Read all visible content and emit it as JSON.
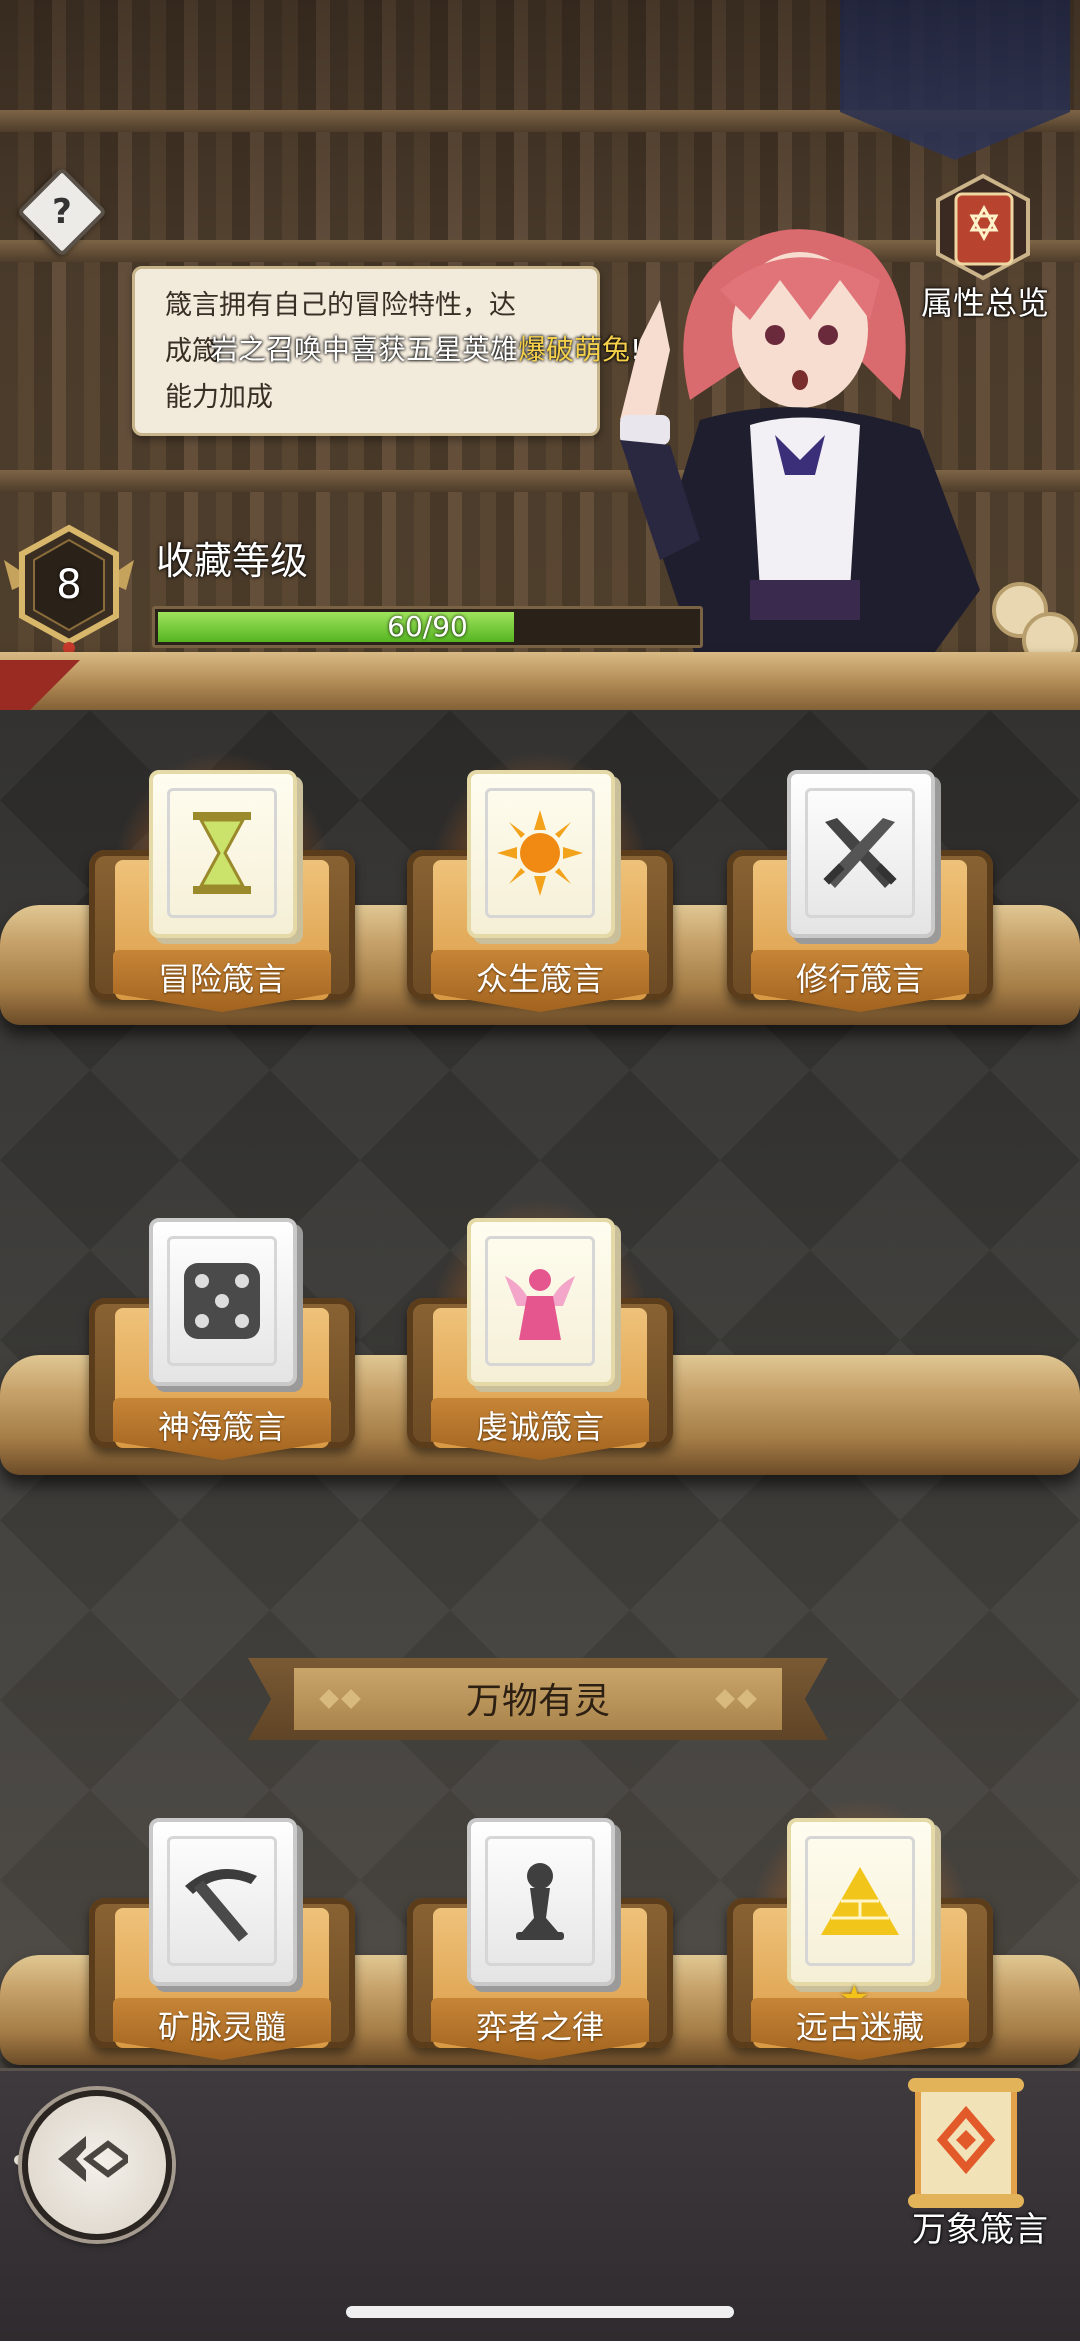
{
  "header": {
    "help_symbol": "?",
    "attributes_label": "属性总览"
  },
  "tooltip": {
    "text": "箴言拥有自己的冒险特性，达成箴言之收集可获得能力加成",
    "line1": "箴言拥有自己的冒险特性，达",
    "line2": "成箴",
    "line3": "能力加成"
  },
  "marquee": {
    "prefix": "岩之召唤中喜获五星英雄",
    "highlight": "爆破萌兔",
    "suffix": "!"
  },
  "collection": {
    "level": "8",
    "label": "收藏等级",
    "progress_text": "60/90",
    "progress_fraction": 0.6667
  },
  "shelf_row1": [
    {
      "label": "冒险箴言",
      "icon": "hourglass-icon",
      "state": "glowing"
    },
    {
      "label": "众生箴言",
      "icon": "sun-icon",
      "state": "glowing"
    },
    {
      "label": "修行箴言",
      "icon": "crossed-swords-icon",
      "state": "grey"
    }
  ],
  "shelf_row2": [
    {
      "label": "神海箴言",
      "icon": "dice-icon",
      "state": "grey"
    },
    {
      "label": "虔诚箴言",
      "icon": "angel-icon",
      "state": "glowing"
    }
  ],
  "section": {
    "title": "万物有灵"
  },
  "shelf_row3": [
    {
      "label": "矿脉灵髓",
      "icon": "pickaxe-icon",
      "state": "grey"
    },
    {
      "label": "弈者之律",
      "icon": "chess-pawn-icon",
      "state": "grey"
    },
    {
      "label": "远古迷藏",
      "icon": "pyramid-icon",
      "state": "glowing",
      "stars": "★"
    }
  ],
  "footer": {
    "wanxiang_label": "万象箴言"
  },
  "colors": {
    "xp_fill": "#7fd03d",
    "gold_text": "#f5d04a",
    "wood": "#c7a36b"
  }
}
